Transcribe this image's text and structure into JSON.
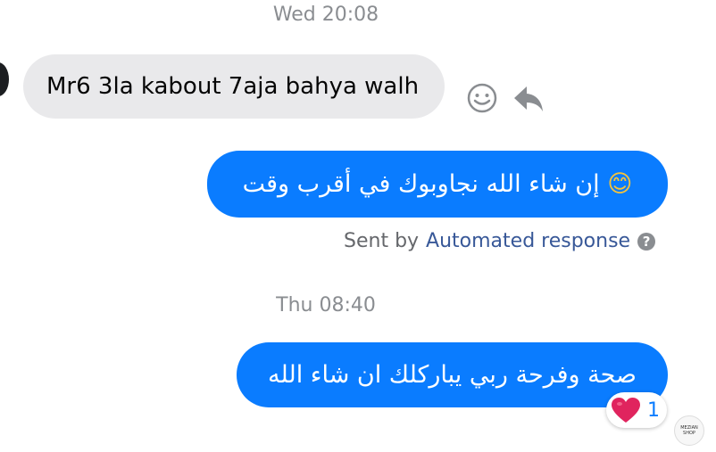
{
  "thread": {
    "timestamp1": "Wed 20:08",
    "timestamp2": "Thu 08:40"
  },
  "messages": {
    "incoming1": {
      "text": "Mr6 3la kabout 7aja bahya walh"
    },
    "outgoing1": {
      "text": "إن شاء الله نجاوبوك في أقرب وقت",
      "emoji": "😊"
    },
    "outgoing2": {
      "text": "صحة وفرحة ربي يباركلك ان شاء الله"
    }
  },
  "sent_by": {
    "prefix": "Sent by",
    "link": "Automated response",
    "help_glyph": "?"
  },
  "reaction": {
    "emoji": "❤",
    "count": "1"
  },
  "seen_avatar": {
    "label": "MEZIAN SHOP"
  },
  "icons": {
    "react": "smiley-icon",
    "reply": "reply-arrow-icon",
    "help": "help-circle-icon",
    "heart": "heart-icon"
  },
  "colors": {
    "outgoing_bubble": "#0a7cff",
    "incoming_bubble": "#e9e9eb",
    "heart": "#e0245e",
    "link": "#385898"
  }
}
